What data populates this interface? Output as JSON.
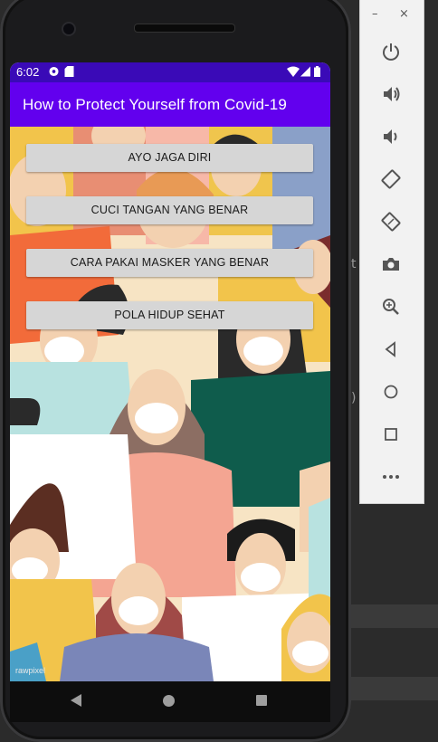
{
  "status_bar": {
    "time": "6:02"
  },
  "app_bar": {
    "title": "How to Protect Yourself from Covid-19"
  },
  "buttons": [
    {
      "label": "AYO JAGA DIRI"
    },
    {
      "label": "CUCI TANGAN YANG BENAR"
    },
    {
      "label": "CARA PAKAI MASKER YANG BENAR"
    },
    {
      "label": "POLA HIDUP SEHAT"
    }
  ],
  "background": {
    "watermark": "rawpixel"
  },
  "emulator_panel": {
    "minimize": "–",
    "close": "×"
  },
  "colors": {
    "status_bar": "#3a0ab7",
    "app_bar": "#6200ee",
    "button": "#d6d6d6"
  }
}
